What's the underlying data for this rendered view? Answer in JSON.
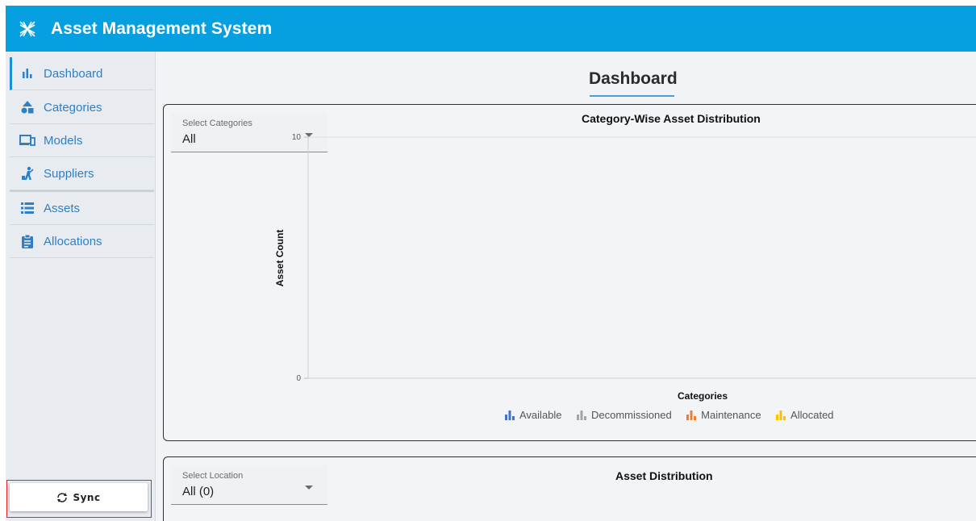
{
  "app": {
    "title": "Asset Management System",
    "accent_color": "#069fe0",
    "logo_icon": "asterisk-grid-icon"
  },
  "sidebar": {
    "items": [
      {
        "label": "Dashboard",
        "icon": "bar-chart-icon",
        "active": true
      },
      {
        "label": "Categories",
        "icon": "shapes-icon",
        "active": false
      },
      {
        "label": "Models",
        "icon": "devices-icon",
        "active": false
      },
      {
        "label": "Suppliers",
        "icon": "person-supplier-icon",
        "active": false
      },
      {
        "label": "Assets",
        "icon": "list-icon",
        "active": false
      },
      {
        "label": "Allocations",
        "icon": "clipboard-icon",
        "active": false
      }
    ],
    "sync_label": "Sync",
    "sync_icon": "sync-icon"
  },
  "main": {
    "page_title": "Dashboard",
    "category_chart_card": {
      "filter_label": "Select Categories",
      "filter_value": "All",
      "title": "Category-Wise Asset Distribution"
    },
    "asset_distribution_card": {
      "filter_label": "Select Location",
      "filter_value": "All (0)",
      "title": "Asset Distribution"
    }
  },
  "chart_data": {
    "type": "bar",
    "title": "Category-Wise Asset Distribution",
    "xlabel": "Categories",
    "ylabel": "Asset Count",
    "ylim": [
      0,
      10
    ],
    "yticks": [
      "0",
      "10"
    ],
    "categories": [],
    "series": [
      {
        "name": "Available",
        "color": "#4472c4",
        "values": []
      },
      {
        "name": "Decommissioned",
        "color": "#a5a5a5",
        "values": []
      },
      {
        "name": "Maintenance",
        "color": "#ed7d31",
        "values": []
      },
      {
        "name": "Allocated",
        "color": "#ffc000",
        "values": []
      }
    ],
    "legend_position": "bottom",
    "grid": false
  }
}
